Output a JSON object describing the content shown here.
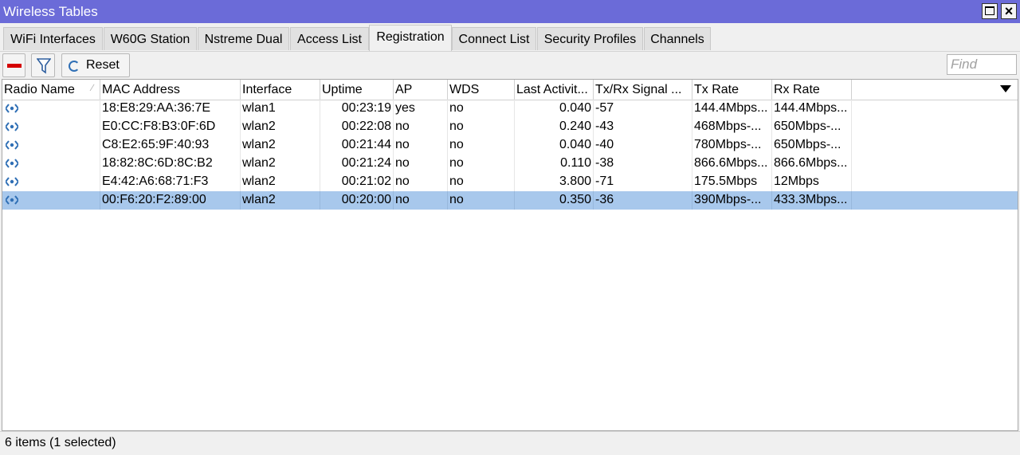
{
  "window": {
    "title": "Wireless Tables"
  },
  "tabs": [
    {
      "label": "WiFi Interfaces"
    },
    {
      "label": "W60G Station"
    },
    {
      "label": "Nstreme Dual"
    },
    {
      "label": "Access List"
    },
    {
      "label": "Registration",
      "active": true
    },
    {
      "label": "Connect List"
    },
    {
      "label": "Security Profiles"
    },
    {
      "label": "Channels"
    }
  ],
  "toolbar": {
    "remove_icon": "minus-icon",
    "filter_icon": "filter-icon",
    "reset_label": "Reset",
    "find_placeholder": "Find"
  },
  "table": {
    "columns": [
      "Radio Name",
      "MAC Address",
      "Interface",
      "Uptime",
      "AP",
      "WDS",
      "Last Activit...",
      "Tx/Rx Signal ...",
      "Tx Rate",
      "Rx Rate"
    ],
    "rows": [
      {
        "radio_name": "",
        "mac": "18:E8:29:AA:36:7E",
        "interface": "wlan1",
        "uptime": "00:23:19",
        "ap": "yes",
        "wds": "no",
        "last_activity": "0.040",
        "signal": "-57",
        "tx_rate": "144.4Mbps...",
        "rx_rate": "144.4Mbps..."
      },
      {
        "radio_name": "",
        "mac": "E0:CC:F8:B3:0F:6D",
        "interface": "wlan2",
        "uptime": "00:22:08",
        "ap": "no",
        "wds": "no",
        "last_activity": "0.240",
        "signal": "-43",
        "tx_rate": "468Mbps-...",
        "rx_rate": "650Mbps-..."
      },
      {
        "radio_name": "",
        "mac": "C8:E2:65:9F:40:93",
        "interface": "wlan2",
        "uptime": "00:21:44",
        "ap": "no",
        "wds": "no",
        "last_activity": "0.040",
        "signal": "-40",
        "tx_rate": "780Mbps-...",
        "rx_rate": "650Mbps-..."
      },
      {
        "radio_name": "",
        "mac": "18:82:8C:6D:8C:B2",
        "interface": "wlan2",
        "uptime": "00:21:24",
        "ap": "no",
        "wds": "no",
        "last_activity": "0.110",
        "signal": "-38",
        "tx_rate": "866.6Mbps...",
        "rx_rate": "866.6Mbps..."
      },
      {
        "radio_name": "",
        "mac": "E4:42:A6:68:71:F3",
        "interface": "wlan2",
        "uptime": "00:21:02",
        "ap": "no",
        "wds": "no",
        "last_activity": "3.800",
        "signal": "-71",
        "tx_rate": "175.5Mbps",
        "rx_rate": "12Mbps"
      },
      {
        "radio_name": "",
        "mac": "00:F6:20:F2:89:00",
        "interface": "wlan2",
        "uptime": "00:20:00",
        "ap": "no",
        "wds": "no",
        "last_activity": "0.350",
        "signal": "-36",
        "tx_rate": "390Mbps-...",
        "rx_rate": "433.3Mbps...",
        "selected": true
      }
    ]
  },
  "status": {
    "text": "6 items (1 selected)"
  },
  "colors": {
    "titlebar": "#6b6bd8",
    "selected_row": "#a8c8ec",
    "remove": "#d40000"
  }
}
